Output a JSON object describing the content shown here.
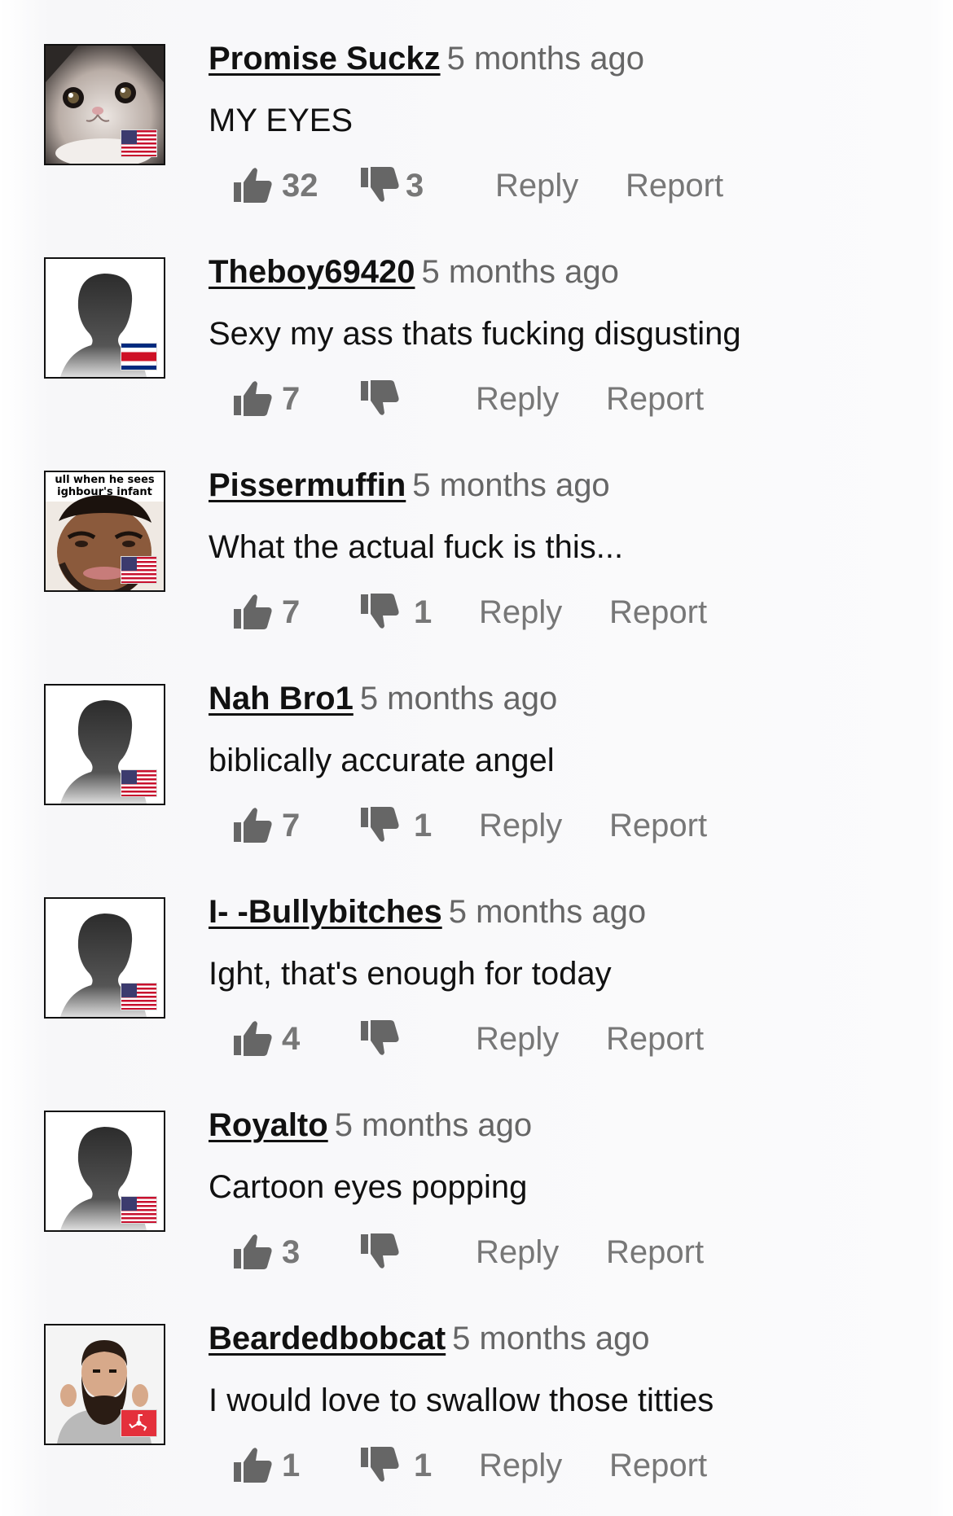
{
  "comments": [
    {
      "username": "Promise Suckz",
      "time": "5 months ago",
      "text": "MY EYES",
      "likes": "32",
      "dislikes": "3",
      "avatar": "cat-avatar",
      "flag": "us"
    },
    {
      "username": "Theboy69420",
      "time": "5 months ago",
      "text": "Sexy my ass thats fucking disgusting",
      "likes": "7",
      "dislikes": "",
      "avatar": "default-silhouette",
      "flag": "cr"
    },
    {
      "username": "Pissermuffin",
      "time": "5 months ago",
      "text": "What the actual fuck is this...",
      "likes": "7",
      "dislikes": "1",
      "avatar": "meme-face",
      "flag": "us",
      "avatar_caption_1": "ull when he sees",
      "avatar_caption_2": "ighbour's infant"
    },
    {
      "username": "Nah Bro1",
      "time": "5 months ago",
      "text": "biblically accurate angel",
      "likes": "7",
      "dislikes": "1",
      "avatar": "default-silhouette",
      "flag": "us"
    },
    {
      "username": "I- -Bullybitches",
      "time": "5 months ago",
      "text": "Ight, that's enough for today",
      "likes": "4",
      "dislikes": "",
      "avatar": "default-silhouette",
      "flag": "us"
    },
    {
      "username": "Royalto",
      "time": "5 months ago",
      "text": "Cartoon eyes popping",
      "likes": "3",
      "dislikes": "",
      "avatar": "default-silhouette",
      "flag": "us"
    },
    {
      "username": "Beardedbobcat",
      "time": "5 months ago",
      "text": "I would love to swallow those titties",
      "likes": "1",
      "dislikes": "1",
      "avatar": "bearded-man",
      "flag": "im"
    }
  ],
  "labels": {
    "reply": "Reply",
    "report": "Report"
  },
  "colors": {
    "username": "#111111",
    "meta": "#666666",
    "action": "#777777"
  }
}
